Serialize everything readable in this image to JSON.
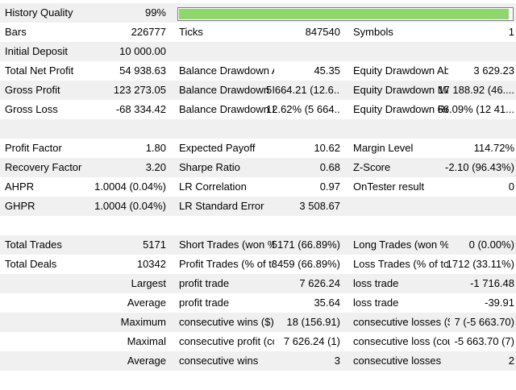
{
  "history_quality": {
    "label": "History Quality",
    "value": "99%",
    "fraction": 0.99,
    "bar_color": "#8fd66f"
  },
  "row_bars": {
    "l1": "Bars",
    "v1": "226777",
    "l2": "Ticks",
    "v2": "847540",
    "l3": "Symbols",
    "v3": "1"
  },
  "row_deposit": {
    "l1": "Initial Deposit",
    "v1": "10 000.00"
  },
  "row_net_profit": {
    "l1": "Total Net Profit",
    "v1": "54 938.63",
    "l2": "Balance Drawdown A...",
    "v2": "45.35",
    "l3": "Equity Drawdown Abs...",
    "v3": "3 629.23"
  },
  "row_gross_profit": {
    "l1": "Gross Profit",
    "v1": "123 273.05",
    "l2": "Balance Drawdown M...",
    "v2": "5 664.21 (12.6...",
    "l3": "Equity Drawdown Ma...",
    "v3": "17 188.92 (46...."
  },
  "row_gross_loss": {
    "l1": "Gross Loss",
    "v1": "-68 334.42",
    "l2": "Balance Drawdown Re...",
    "v2": "12.62% (5 664....",
    "l3": "Equity Drawdown Rel...",
    "v3": "66.09% (12 41..."
  },
  "row_profit_factor": {
    "l1": "Profit Factor",
    "v1": "1.80",
    "l2": "Expected Payoff",
    "v2": "10.62",
    "l3": "Margin Level",
    "v3": "114.72%"
  },
  "row_recovery": {
    "l1": "Recovery Factor",
    "v1": "3.20",
    "l2": "Sharpe Ratio",
    "v2": "0.68",
    "l3": "Z-Score",
    "v3": "-2.10 (96.43%)"
  },
  "row_ahpr": {
    "l1": "AHPR",
    "v1": "1.0004 (0.04%)",
    "l2": "LR Correlation",
    "v2": "0.97",
    "l3": "OnTester result",
    "v3": "0"
  },
  "row_ghpr": {
    "l1": "GHPR",
    "v1": "1.0004 (0.04%)",
    "l2": "LR Standard Error",
    "v2": "3 508.67"
  },
  "row_total_trades": {
    "l1": "Total Trades",
    "v1": "5171",
    "l2": "Short Trades (won %)",
    "v2": "5171 (66.89%)",
    "l3": "Long Trades (won %)",
    "v3": "0 (0.00%)"
  },
  "row_total_deals": {
    "l1": "Total Deals",
    "v1": "10342",
    "l2": "Profit Trades (% of tot...",
    "v2": "3459 (66.89%)",
    "l3": "Loss Trades (% of total)",
    "v3": "1712 (33.11%)"
  },
  "row_largest": {
    "l1": "Largest",
    "l2": "profit trade",
    "v2": "7 626.24",
    "l3": "loss trade",
    "v3": "-1 716.48"
  },
  "row_average1": {
    "l1": "Average",
    "l2": "profit trade",
    "v2": "35.64",
    "l3": "loss trade",
    "v3": "-39.91"
  },
  "row_maximum": {
    "l1": "Maximum",
    "l2": "consecutive wins ($)",
    "v2": "18 (156.91)",
    "l3": "consecutive losses ($)",
    "v3": "7 (-5 663.70)"
  },
  "row_maximal": {
    "l1": "Maximal",
    "l2": "consecutive profit (co...",
    "v2": "7 626.24 (1)",
    "l3": "consecutive loss (cou...",
    "v3": "-5 663.70 (7)"
  },
  "row_average2": {
    "l1": "Average",
    "l2": "consecutive wins",
    "v2": "3",
    "l3": "consecutive losses",
    "v3": "2"
  }
}
